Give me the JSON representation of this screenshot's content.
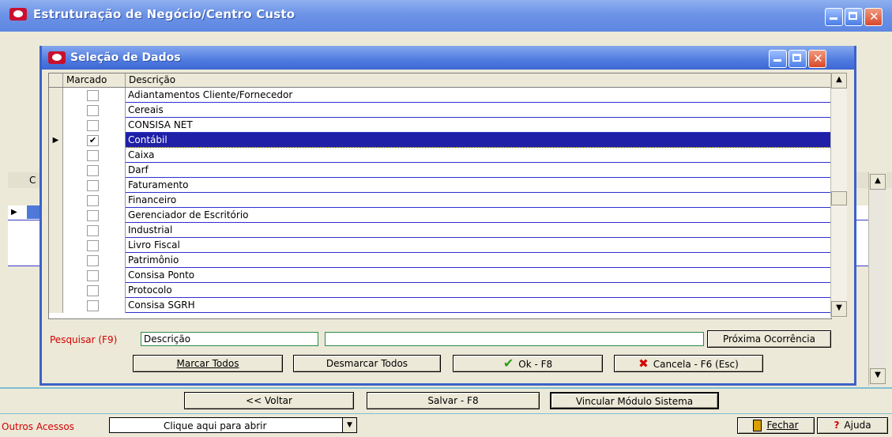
{
  "window": {
    "title": "Estruturação de Negócio/Centro Custo"
  },
  "modal": {
    "title": "Seleção de Dados"
  },
  "grid": {
    "headers": {
      "marcado": "Marcado",
      "descricao": "Descrição"
    },
    "rows": [
      {
        "label": "Adiantamentos Cliente/Fornecedor",
        "checked": false
      },
      {
        "label": "Cereais",
        "checked": false
      },
      {
        "label": "CONSISA NET",
        "checked": false
      },
      {
        "label": "Contábil",
        "checked": true,
        "selected": true
      },
      {
        "label": "Caixa",
        "checked": false
      },
      {
        "label": "Darf",
        "checked": false
      },
      {
        "label": "Faturamento",
        "checked": false
      },
      {
        "label": "Financeiro",
        "checked": false
      },
      {
        "label": "Gerenciador de Escritório",
        "checked": false
      },
      {
        "label": "Industrial",
        "checked": false
      },
      {
        "label": "Livro Fiscal",
        "checked": false
      },
      {
        "label": "Patrimônio",
        "checked": false
      },
      {
        "label": "Consisa Ponto",
        "checked": false
      },
      {
        "label": "Protocolo",
        "checked": false
      },
      {
        "label": "Consisa SGRH",
        "checked": false
      }
    ]
  },
  "search": {
    "label": "Pesquisar (F9)",
    "field_value": "Descrição",
    "text_value": "",
    "next_label": "Próxima Ocorrência"
  },
  "modal_buttons": {
    "marcar_todos": "Marcar Todos",
    "desmarcar_todos": "Desmarcar Todos",
    "ok": "Ok - F8",
    "cancela": "Cancela - F6 (Esc)"
  },
  "background": {
    "grid_header_fragment": "C"
  },
  "footer": {
    "voltar": "<< Voltar",
    "salvar": "Salvar - F8",
    "vincular": "Vincular Módulo Sistema",
    "outros_label": "Outros Acessos",
    "combo_value": "Clique aqui para abrir",
    "fechar": "Fechar",
    "ajuda": "Ajuda"
  },
  "colors": {
    "selection": "#1f1fa7",
    "grid_line": "#2f2fd0",
    "accent_red": "#d40000",
    "titlebar": "#5e86e2"
  }
}
